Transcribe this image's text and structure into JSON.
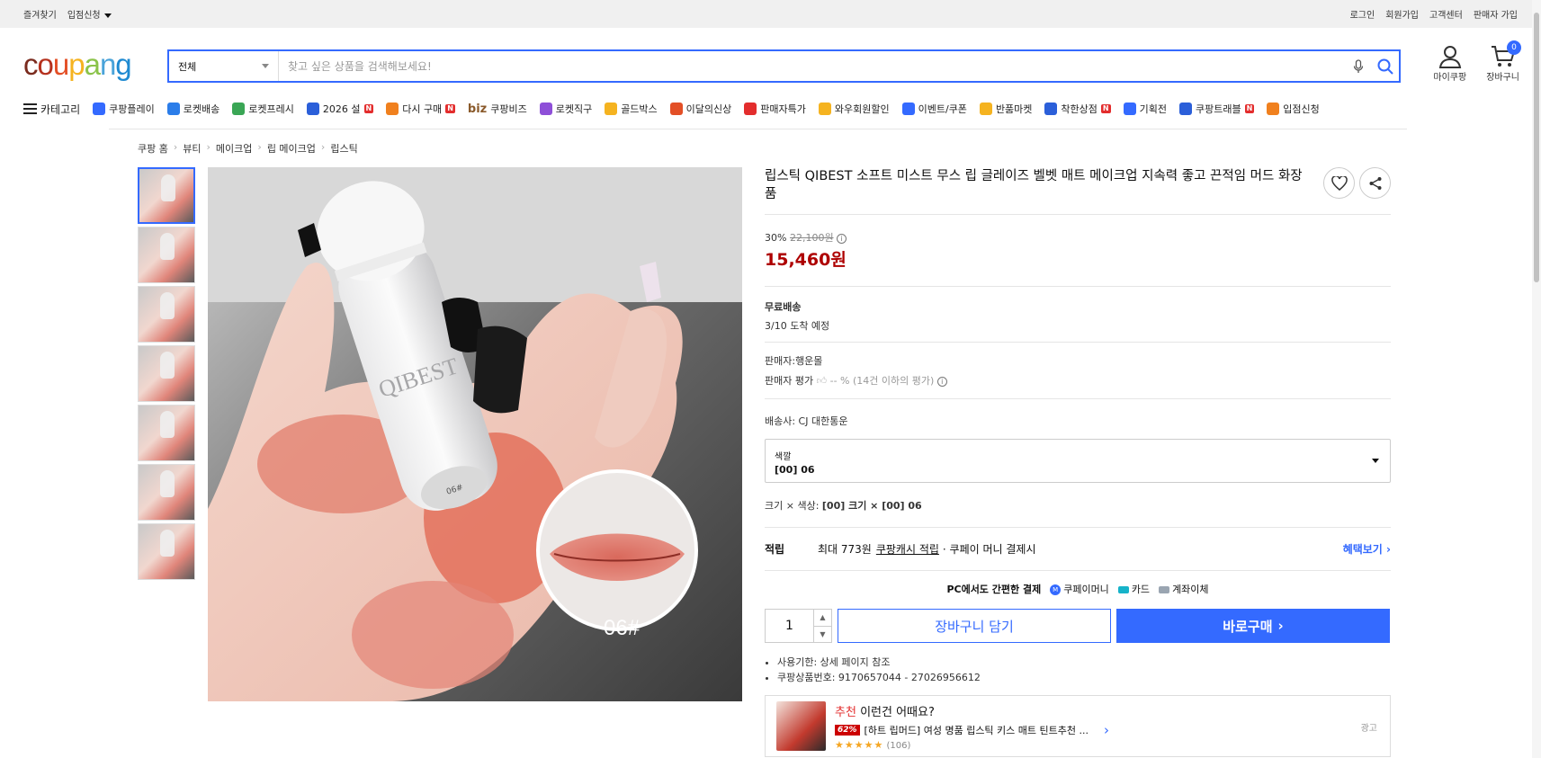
{
  "topbar": {
    "left": [
      "즐겨찾기",
      "입점신청"
    ],
    "right": [
      "로그인",
      "회원가입",
      "고객센터",
      "판매자 가입"
    ]
  },
  "logo": [
    "c",
    "o",
    "u",
    "p",
    "a",
    "n",
    "g"
  ],
  "search": {
    "category": "전체",
    "placeholder": "찾고 싶은 상품을 검색해보세요!"
  },
  "header_icons": {
    "mypage": "마이쿠팡",
    "cart": "장바구니",
    "cart_count": "0"
  },
  "nav": {
    "category": "카테고리",
    "items": [
      {
        "label": "쿠팡플레이",
        "color": "#346aff"
      },
      {
        "label": "로켓배송",
        "color": "#2b7de9"
      },
      {
        "label": "로켓프레시",
        "color": "#3aa655"
      },
      {
        "label": "2026 설",
        "color": "#2b5fd9",
        "badge": "N"
      },
      {
        "label": "다시 구매",
        "color": "#f0801e",
        "badge": "N"
      },
      {
        "label": "쿠팡비즈",
        "color": "#8a5a2b",
        "prefix": "biz"
      },
      {
        "label": "로켓직구",
        "color": "#8e4fd8"
      },
      {
        "label": "골드박스",
        "color": "#f5b320"
      },
      {
        "label": "이달의신상",
        "color": "#e34f26"
      },
      {
        "label": "판매자특가",
        "color": "#e32d2d"
      },
      {
        "label": "와우회원할인",
        "color": "#f5b320"
      },
      {
        "label": "이벤트/쿠폰",
        "color": "#346aff"
      },
      {
        "label": "반품마켓",
        "color": "#f5b320"
      },
      {
        "label": "착한상점",
        "color": "#2b5fd9",
        "badge": "N"
      },
      {
        "label": "기획전",
        "color": "#346aff"
      },
      {
        "label": "쿠팡트래블",
        "color": "#2b5fd9",
        "badge": "N"
      },
      {
        "label": "입점신청",
        "color": "#f0801e"
      }
    ]
  },
  "breadcrumb": [
    "쿠팡 홈",
    "뷰티",
    "메이크업",
    "립 메이크업",
    "립스틱"
  ],
  "product": {
    "title": "립스틱 QIBEST 소프트 미스트 무스 립 글레이즈 벨벳 매트 메이크업 지속력 좋고 끈적임 머드 화장품",
    "discount": "30%",
    "original_price": "22,100원",
    "price": "15,460원",
    "delivery_label": "무료배송",
    "delivery_date": "3/10 도착 예정",
    "seller": "판매자:행운몰",
    "seller_rating_label": "판매자 평가",
    "seller_rating_value": "-- %",
    "seller_rating_note": "(14건 이하의 평가)",
    "shipper": "배송사:  CJ 대한통운",
    "option_label": "색깔",
    "option_value": "[00] 06",
    "summary_prefix": "크기 × 색상:",
    "summary_value": "[00] 크기 × [00] 06",
    "reward_label": "적립",
    "reward_text1": "최대 773원",
    "reward_link": "쿠팡캐시 적립",
    "reward_text2": "· 쿠페이 머니 결제시",
    "reward_more": "혜택보기",
    "pc_pay": "PC에서도 간편한 결제",
    "pay_methods": [
      "쿠페이머니",
      "카드",
      "계좌이체"
    ],
    "quantity": "1",
    "cart_button": "장바구니 담기",
    "buy_button": "바로구매",
    "notes": [
      "사용기한: 상세 페이지 참조",
      "쿠팡상품번호: 9170657044 - 27026956612"
    ],
    "image_label": "06#",
    "bottle_text": "QIBEST",
    "bottle_code": "06#"
  },
  "recommend": {
    "title_red": "추천",
    "title": "이런건 어때요?",
    "discount": "62%",
    "name": "[하트 립머드] 여성 명품 립스틱 키스 매트 틴트추천 ...",
    "stars": "★★★★★",
    "reviews": "(106)",
    "ad": "광고"
  }
}
